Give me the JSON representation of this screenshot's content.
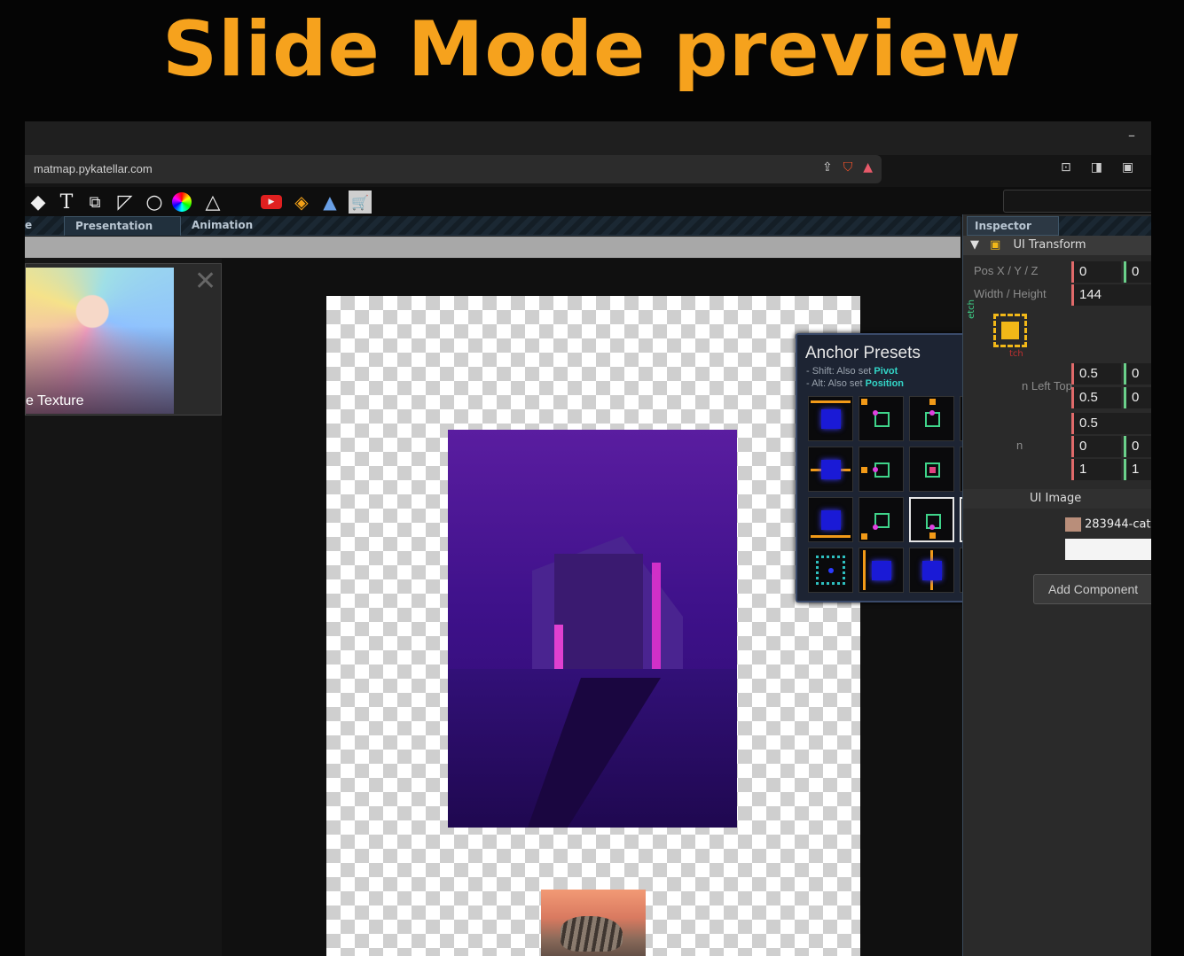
{
  "headline": "Slide Mode preview",
  "browser": {
    "url": "matmap.pykatellar.com",
    "minimize": "–"
  },
  "tabs": [
    "e",
    "Presentation",
    "Animation"
  ],
  "left_panel": {
    "texture_label": "e Texture"
  },
  "anchor_presets": {
    "title": "Anchor Presets",
    "hint1_prefix": "- Shift: Also set ",
    "hint1_key": "Pivot",
    "hint2_prefix": "- Alt: Also set ",
    "hint2_key": "Position"
  },
  "inspector": {
    "tab": "Inspector",
    "ui_transform": "UI Transform",
    "pos_label": "Pos X / Y / Z",
    "wh_label": "Width / Height",
    "pos_x": "0",
    "pos_y": "0",
    "width": "144",
    "stretch_label": "etch",
    "stretch_label2": "tch",
    "left_top_label": "n Left Top",
    "min_x": "0.5",
    "min_y": "0",
    "max_x": "0.5",
    "max_y": "0",
    "pivot": "0.5",
    "n_label": "n",
    "rot_x": "0",
    "rot_y": "0",
    "scale_x": "1",
    "scale_y": "1",
    "ui_image": "UI Image",
    "image_name": "283944-cat",
    "add_component": "Add Component"
  },
  "colors": {
    "accent": "#f6a21d",
    "anchor_orange": "#f29a18",
    "anchor_green": "#3fd48a"
  },
  "icons": [
    "eraser-icon",
    "text-icon",
    "shapes-icon",
    "line-icon",
    "circle-icon",
    "color-wheel-icon",
    "triangle-icon",
    "youtube-icon",
    "gem-icon",
    "graduation-icon",
    "cart-icon"
  ]
}
